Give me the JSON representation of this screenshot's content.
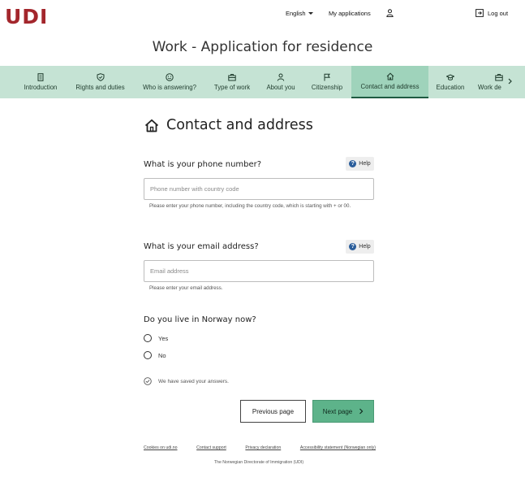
{
  "header": {
    "logo": "UDI",
    "language": "English",
    "my_applications": "My applications",
    "logout": "Log out"
  },
  "page_title": "Work - Application for residence",
  "steps": [
    {
      "label": "Introduction",
      "icon": "document-icon"
    },
    {
      "label": "Rights and duties",
      "icon": "shield-icon"
    },
    {
      "label": "Who is answering?",
      "icon": "smiley-icon"
    },
    {
      "label": "Type of work",
      "icon": "briefcase-icon"
    },
    {
      "label": "About you",
      "icon": "person-icon"
    },
    {
      "label": "Citizenship",
      "icon": "flag-icon"
    },
    {
      "label": "Contact and address",
      "icon": "home-icon",
      "active": true
    },
    {
      "label": "Education",
      "icon": "graduation-cap-icon"
    },
    {
      "label": "Work de",
      "icon": "briefcase-icon"
    }
  ],
  "section": {
    "title": "Contact and address",
    "icon": "home-icon"
  },
  "form": {
    "help_label": "Help",
    "phone": {
      "question": "What is your phone number?",
      "placeholder": "Phone number with country code",
      "hint": "Please enter your phone number, including the country code, which is starting with + or 00."
    },
    "email": {
      "question": "What is your email address?",
      "placeholder": "Email address",
      "hint": "Please enter your email address."
    },
    "norway": {
      "question": "Do you live in Norway now?",
      "options": [
        "Yes",
        "No"
      ]
    },
    "saved_message": "We have saved your answers.",
    "previous_label": "Previous page",
    "next_label": "Next page"
  },
  "footer": {
    "links": [
      "Cookies on udi.no",
      "Contact support",
      "Privacy declaration",
      "Accessibility statement (Norwegian only)"
    ],
    "org": "The Norwegian Directorate of Immigration (UDI)"
  },
  "colors": {
    "brand": "#a3262c",
    "step_bar": "#c5e3d4",
    "step_active": "#9fd3bb",
    "primary_button": "#5db38a",
    "help_icon": "#2a5d9a"
  }
}
